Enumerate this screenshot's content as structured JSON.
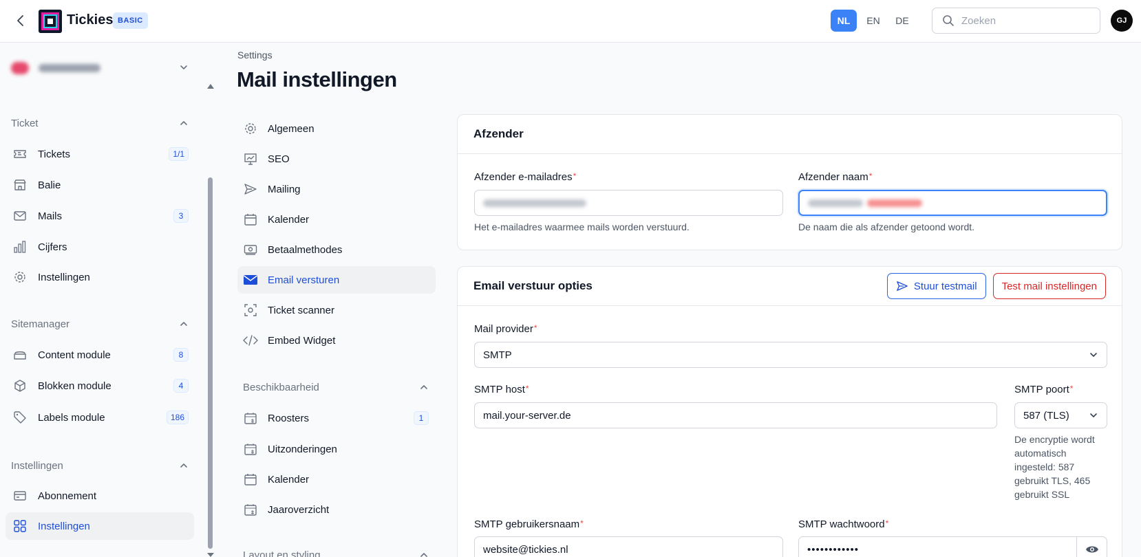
{
  "app": {
    "name": "Tickies",
    "plan_badge": "BASIC"
  },
  "header": {
    "languages": [
      {
        "code": "NL",
        "active": true
      },
      {
        "code": "EN",
        "active": false
      },
      {
        "code": "DE",
        "active": false
      }
    ],
    "search_placeholder": "Zoeken",
    "avatar_initials": "GJ"
  },
  "sidebar": {
    "sections": [
      {
        "title": "Ticket",
        "items": [
          {
            "label": "Tickets",
            "icon": "ticket-icon",
            "count": "1/1"
          },
          {
            "label": "Balie",
            "icon": "store-icon",
            "count": ""
          },
          {
            "label": "Mails",
            "icon": "mail-icon",
            "count": "3"
          },
          {
            "label": "Cijfers",
            "icon": "bar-chart-icon",
            "count": ""
          },
          {
            "label": "Instellingen",
            "icon": "gear-icon",
            "count": ""
          }
        ]
      },
      {
        "title": "Sitemanager",
        "items": [
          {
            "label": "Content module",
            "icon": "layers-icon",
            "count": "8"
          },
          {
            "label": "Blokken module",
            "icon": "cube-icon",
            "count": "4"
          },
          {
            "label": "Labels module",
            "icon": "tag-icon",
            "count": "186"
          }
        ]
      },
      {
        "title": "Instellingen",
        "items": [
          {
            "label": "Abonnement",
            "icon": "credit-card-icon",
            "count": ""
          },
          {
            "label": "Instellingen",
            "icon": "grid-icon",
            "count": "",
            "active": true
          }
        ]
      }
    ]
  },
  "page": {
    "breadcrumb": "Settings",
    "title": "Mail instellingen"
  },
  "settings_menu": {
    "items": [
      {
        "label": "Algemeen",
        "icon": "gear-icon"
      },
      {
        "label": "SEO",
        "icon": "presentation-chart-icon"
      },
      {
        "label": "Mailing",
        "icon": "send-icon"
      },
      {
        "label": "Kalender",
        "icon": "calendar-icon"
      },
      {
        "label": "Betaalmethodes",
        "icon": "banknote-icon"
      },
      {
        "label": "Email versturen",
        "icon": "envelope-icon",
        "active": true
      },
      {
        "label": "Ticket scanner",
        "icon": "scan-icon"
      },
      {
        "label": "Embed Widget",
        "icon": "code-icon"
      }
    ],
    "availability_title": "Beschikbaarheid",
    "availability_items": [
      {
        "label": "Roosters",
        "icon": "calendar-grid-icon",
        "count": "1"
      },
      {
        "label": "Uitzonderingen",
        "icon": "calendar-grid-icon",
        "count": ""
      },
      {
        "label": "Kalender",
        "icon": "calendar-icon",
        "count": ""
      },
      {
        "label": "Jaaroverzicht",
        "icon": "calendar-grid-icon",
        "count": ""
      }
    ],
    "layout_title": "Layout en styling"
  },
  "sender_card": {
    "title": "Afzender",
    "email_label": "Afzender e-mailadres",
    "email_help": "Het e-mailadres waarmee mails worden verstuurd.",
    "name_label": "Afzender naam",
    "name_help": "De naam die als afzender getoond wordt."
  },
  "send_options_card": {
    "title": "Email verstuur opties",
    "test_button": "Stuur testmail",
    "test_settings_button": "Test mail instellingen",
    "provider_label": "Mail provider",
    "provider_value": "SMTP",
    "host_label": "SMTP host",
    "host_value": "mail.your-server.de",
    "port_label": "SMTP poort",
    "port_value": "587 (TLS)",
    "port_help": "De encryptie wordt automatisch ingesteld: 587 gebruikt TLS, 465 gebruikt SSL",
    "username_label": "SMTP gebruikersnaam",
    "username_value": "website@tickies.nl",
    "password_label": "SMTP wachtwoord",
    "password_value": "••••••••••••"
  },
  "colors": {
    "accent": "#3b82f6",
    "active_text": "#1d4ed8",
    "danger": "#dc2626"
  }
}
